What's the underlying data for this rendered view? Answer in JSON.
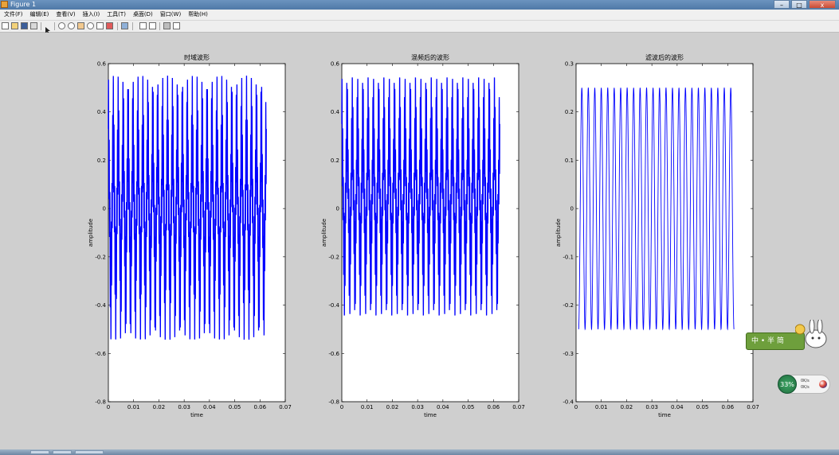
{
  "window": {
    "title": "Figure 1",
    "min_label": "–",
    "max_label": "□",
    "close_label": "x"
  },
  "menu": [
    "文件(F)",
    "编辑(E)",
    "查看(V)",
    "插入(I)",
    "工具(T)",
    "桌面(D)",
    "窗口(W)",
    "帮助(H)"
  ],
  "toolbar_icons": [
    "new-figure-icon",
    "open-icon",
    "save-icon",
    "print-icon",
    "pointer-icon",
    "zoom-in-icon",
    "zoom-out-icon",
    "pan-icon",
    "rotate-icon",
    "data-cursor-icon",
    "brush-icon",
    "link-icon",
    "colorbar-icon",
    "legend-icon",
    "plot-tools-hide-icon",
    "plot-tools-show-icon"
  ],
  "chart_data": [
    {
      "type": "line",
      "title": "时域波形",
      "xlabel": "time",
      "ylabel": "amplitude",
      "xlim": [
        0,
        0.07
      ],
      "ylim": [
        -0.8,
        0.6
      ],
      "xticks": [
        0,
        0.01,
        0.02,
        0.03,
        0.04,
        0.05,
        0.06,
        0.07
      ],
      "yticks": [
        -0.8,
        -0.6,
        -0.4,
        -0.2,
        0,
        0.2,
        0.4,
        0.6
      ],
      "tick_labels_x": [
        "0",
        "0.01",
        "0.02",
        "0.03",
        "0.04",
        "0.05",
        "0.06",
        "0.07"
      ],
      "tick_labels_y": [
        "-0.8",
        "-0.6",
        "-0.4",
        "-0.2",
        "0",
        "0.2",
        "0.4",
        "0.6"
      ],
      "series": [
        {
          "color": "#0000ff",
          "x_range": [
            0,
            0.0625
          ],
          "cycles": 32,
          "envelope": [
            -0.55,
            0.55
          ],
          "dense": true
        }
      ]
    },
    {
      "type": "line",
      "title": "混频后的波形",
      "xlabel": "time",
      "ylabel": "amplitude",
      "xlim": [
        0,
        0.07
      ],
      "ylim": [
        -0.8,
        0.6
      ],
      "xticks": [
        0,
        0.01,
        0.02,
        0.03,
        0.04,
        0.05,
        0.06,
        0.07
      ],
      "yticks": [
        -0.8,
        -0.6,
        -0.4,
        -0.2,
        0,
        0.2,
        0.4,
        0.6
      ],
      "tick_labels_x": [
        "0",
        "0.01",
        "0.02",
        "0.03",
        "0.04",
        "0.05",
        "0.06",
        "0.07"
      ],
      "tick_labels_y": [
        "-0.8",
        "-0.6",
        "-0.4",
        "-0.2",
        "0",
        "0.2",
        "0.4",
        "0.6"
      ],
      "series": [
        {
          "color": "#0000ff",
          "x_range": [
            0,
            0.0625
          ],
          "cycles": 30,
          "envelope": [
            -0.45,
            0.55
          ],
          "dense": true
        }
      ]
    },
    {
      "type": "line",
      "title": "滤波后的波形",
      "xlabel": "time",
      "ylabel": "amplitude",
      "xlim": [
        0,
        0.07
      ],
      "ylim": [
        -0.4,
        0.3
      ],
      "xticks": [
        0,
        0.01,
        0.02,
        0.03,
        0.04,
        0.05,
        0.06,
        0.07
      ],
      "yticks": [
        -0.4,
        -0.3,
        -0.2,
        -0.1,
        0,
        0.1,
        0.2,
        0.3
      ],
      "tick_labels_x": [
        "0",
        "0.01",
        "0.02",
        "0.03",
        "0.04",
        "0.05",
        "0.06",
        "0.07"
      ],
      "tick_labels_y": [
        "-0.4",
        "-0.3",
        "-0.2",
        "-0.1",
        "0",
        "0.1",
        "0.2",
        "0.3"
      ],
      "series": [
        {
          "color": "#0000ff",
          "x_range": [
            0.001,
            0.0625
          ],
          "cycles": 24,
          "envelope": [
            -0.25,
            0.25
          ],
          "dense": false
        }
      ]
    }
  ],
  "ime": {
    "label": "中 • 半 简"
  },
  "net_meter": {
    "percent": "33%",
    "up": "0K/s",
    "down": "0K/s"
  }
}
